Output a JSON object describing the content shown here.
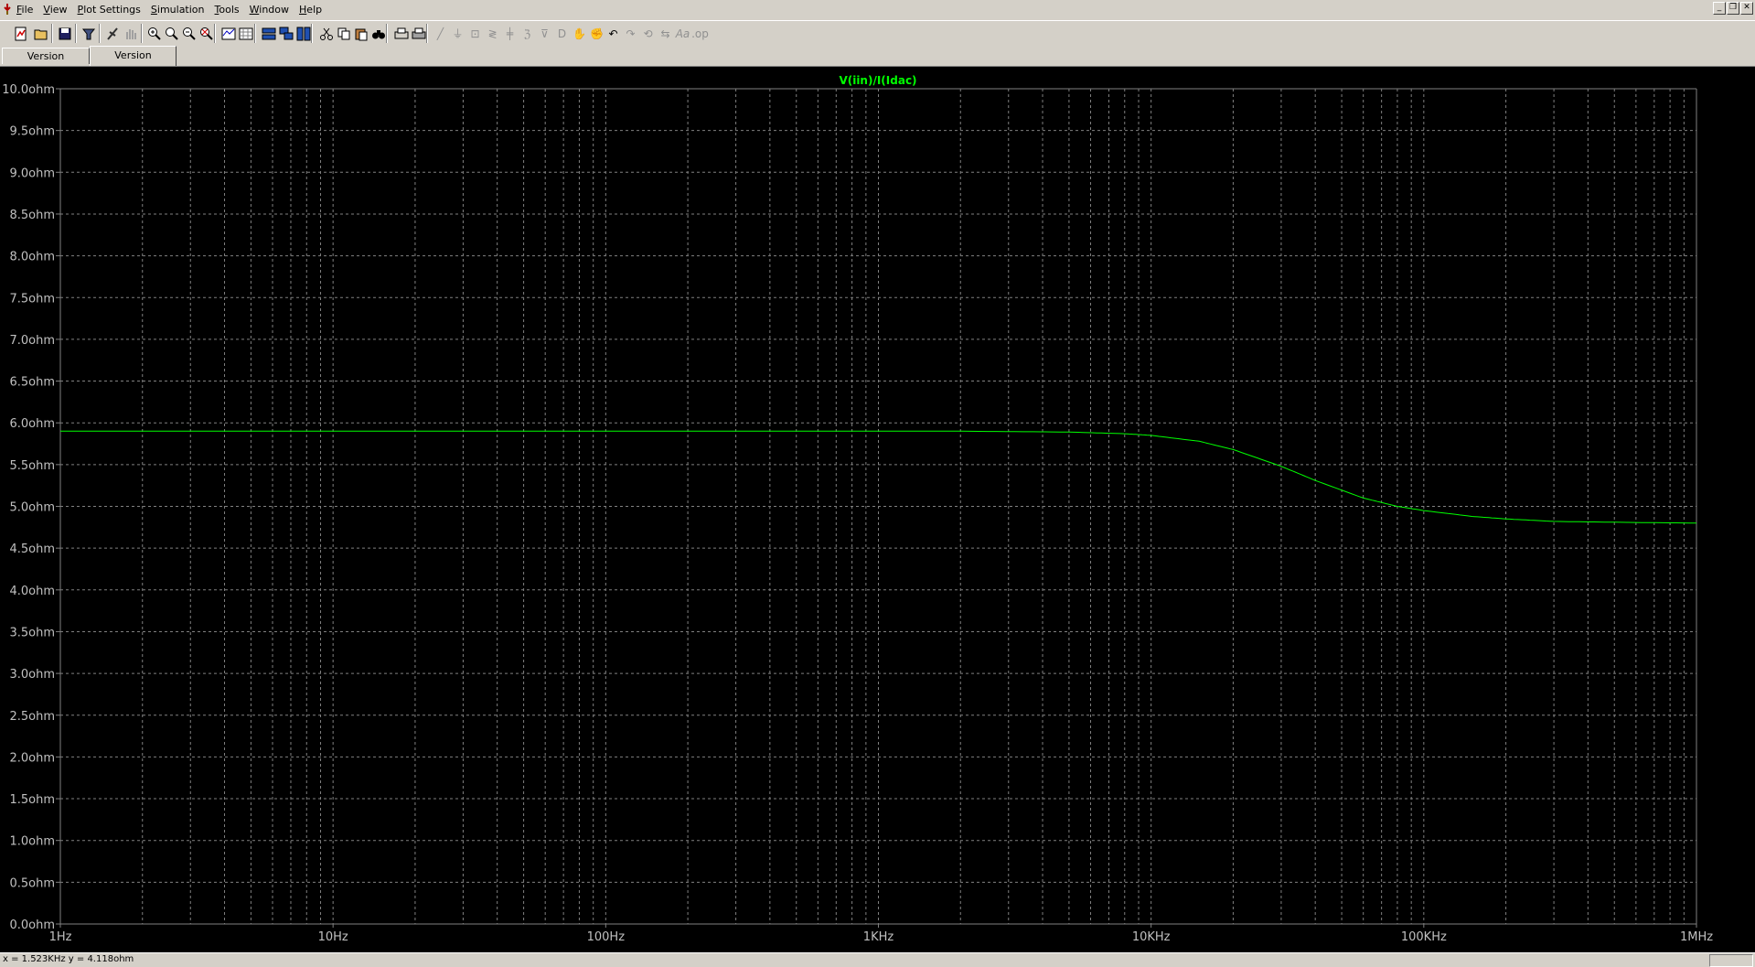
{
  "menu": {
    "items": [
      "File",
      "View",
      "Plot Settings",
      "Simulation",
      "Tools",
      "Window",
      "Help"
    ]
  },
  "toolbar": {
    "icons": [
      "new-schematic-icon",
      "open-icon",
      "save-icon",
      "control-panel-icon",
      "run-icon",
      "halt-icon",
      "zoom-in-icon",
      "zoom-area-icon",
      "zoom-out-icon",
      "zoom-full-icon",
      "autorange-icon",
      "grid-icon",
      "tile-horizontal-icon",
      "cascade-icon",
      "tile-vertical-icon",
      "cut-icon",
      "copy-icon",
      "paste-icon",
      "find-icon",
      "print-preview-icon",
      "print-icon",
      "wire-icon",
      "ground-icon",
      "label-icon",
      "resistor-icon",
      "capacitor-icon",
      "inductor-icon",
      "diode-icon",
      "component-icon",
      "move-icon",
      "drag-icon",
      "undo-icon",
      "redo-icon",
      "rotate-icon",
      "mirror-icon",
      "text-icon",
      "spice-directive-icon"
    ]
  },
  "tabs": [
    {
      "label": "Version PBen.asc",
      "active": false
    },
    {
      "label": "Version PBen.asc",
      "active": true
    }
  ],
  "plot": {
    "trace_label": "V(iin)/I(Idac)",
    "trace_color": "#00ff00",
    "background": "#000000",
    "grid_color": "#808080"
  },
  "chart_data": {
    "type": "line",
    "title": "V(iin)/I(Idac)",
    "x_scale": "log",
    "xlim": [
      1,
      1000000
    ],
    "ylim": [
      0,
      10
    ],
    "x_tick_labels": [
      "1Hz",
      "10Hz",
      "100Hz",
      "1KHz",
      "10KHz",
      "100KHz",
      "1MHz"
    ],
    "y_tick_labels": [
      "10.0ohm",
      "9.5ohm",
      "9.0ohm",
      "8.5ohm",
      "8.0ohm",
      "7.5ohm",
      "7.0ohm",
      "6.5ohm",
      "6.0ohm",
      "5.5ohm",
      "5.0ohm",
      "4.5ohm",
      "4.0ohm",
      "3.5ohm",
      "3.0ohm",
      "2.5ohm",
      "2.0ohm",
      "1.5ohm",
      "1.0ohm",
      "0.5ohm",
      "0.0ohm"
    ],
    "grid": true,
    "series": [
      {
        "color": "#00ff00",
        "x": [
          1,
          10,
          100,
          1000,
          2000,
          5000,
          8000,
          10000,
          15000,
          20000,
          30000,
          40000,
          60000,
          80000,
          100000,
          150000,
          200000,
          300000,
          500000,
          1000000
        ],
        "y": [
          5.9,
          5.9,
          5.9,
          5.9,
          5.9,
          5.89,
          5.87,
          5.85,
          5.78,
          5.68,
          5.48,
          5.31,
          5.1,
          5.0,
          4.95,
          4.88,
          4.85,
          4.82,
          4.81,
          4.8
        ]
      }
    ]
  },
  "status": {
    "cursor_readout": "x = 1.523KHz   y = 4.118ohm"
  }
}
